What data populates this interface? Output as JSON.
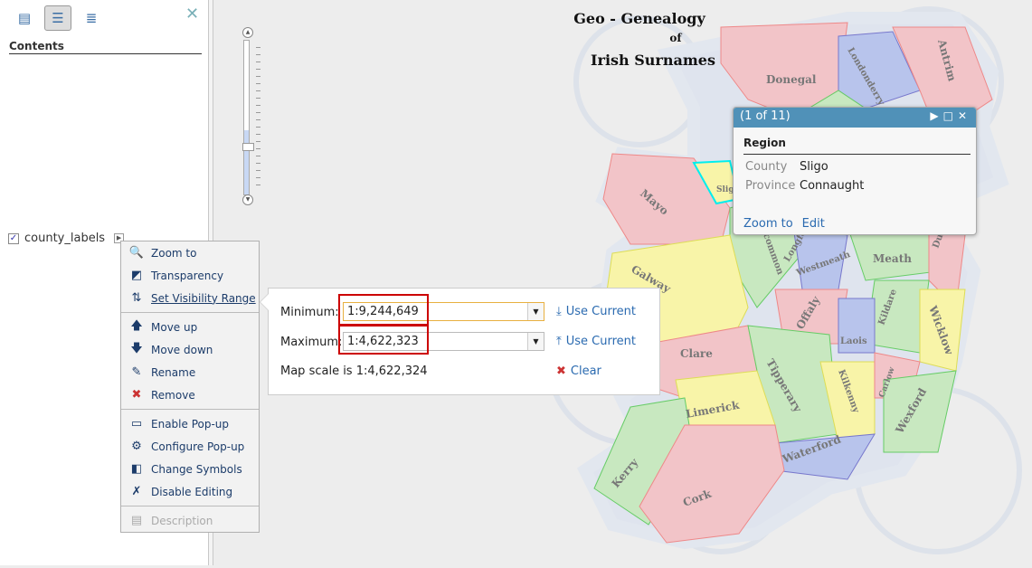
{
  "sidebar": {
    "title": "Contents",
    "tools": [
      {
        "icon": "details-icon"
      },
      {
        "icon": "contents-icon",
        "active": true
      },
      {
        "icon": "legend-icon"
      }
    ],
    "close_icon": "close-icon",
    "layer": {
      "name": "county_labels",
      "checked": true
    }
  },
  "zoom_slider": {
    "level_fraction": 0.42
  },
  "context_menu": {
    "groups": [
      [
        {
          "label": "Zoom to",
          "icon": "zoom-to-icon"
        },
        {
          "label": "Transparency",
          "icon": "transparency-icon"
        },
        {
          "label": "Set Visibility Range",
          "icon": "visibility-range-icon",
          "active": true
        }
      ],
      [
        {
          "label": "Move up",
          "icon": "arrow-up-icon"
        },
        {
          "label": "Move down",
          "icon": "arrow-down-icon"
        },
        {
          "label": "Rename",
          "icon": "rename-icon"
        },
        {
          "label": "Remove",
          "icon": "remove-icon"
        }
      ],
      [
        {
          "label": "Enable Pop-up",
          "icon": "popup-icon"
        },
        {
          "label": "Configure Pop-up",
          "icon": "configure-popup-icon"
        },
        {
          "label": "Change Symbols",
          "icon": "symbols-icon"
        },
        {
          "label": "Disable Editing",
          "icon": "disable-editing-icon"
        }
      ],
      [
        {
          "label": "Description",
          "icon": "description-icon",
          "disabled": true
        }
      ]
    ]
  },
  "visibility": {
    "min_label": "Minimum:",
    "min_value": "1:9,244,649",
    "max_label": "Maximum:",
    "max_value": "1:4,622,323",
    "scale_text": "Map scale is 1:4,622,324",
    "use_current": "Use Current",
    "clear": "Clear"
  },
  "map": {
    "title_line1": "Geo - Genealogy",
    "title_line2": "of",
    "title_line3": "Irish Surnames",
    "counties": [
      "Donegal",
      "Londonderry",
      "Antrim",
      "Mayo",
      "Sligo",
      "Galway",
      "Roscommon",
      "Longford",
      "Westmeath",
      "Meath",
      "Dublin",
      "Offaly",
      "Kildare",
      "Wicklow",
      "Laois",
      "Clare",
      "Tipperary",
      "Kilkenny",
      "Carlow",
      "Wexford",
      "Limerick",
      "Waterford",
      "Kerry",
      "Cork"
    ],
    "colors": {
      "pink": "#f2c4c8",
      "green": "#c8e8c0",
      "yellow": "#f8f4a8",
      "blue": "#b8c4ec",
      "sea": "#dfe4ee"
    }
  },
  "popup": {
    "counter": "(1 of 11)",
    "title": "Region",
    "fields": [
      {
        "key": "County",
        "value": "Sligo"
      },
      {
        "key": "Province",
        "value": "Connaught"
      }
    ],
    "zoom_to": "Zoom to",
    "edit": "Edit"
  }
}
